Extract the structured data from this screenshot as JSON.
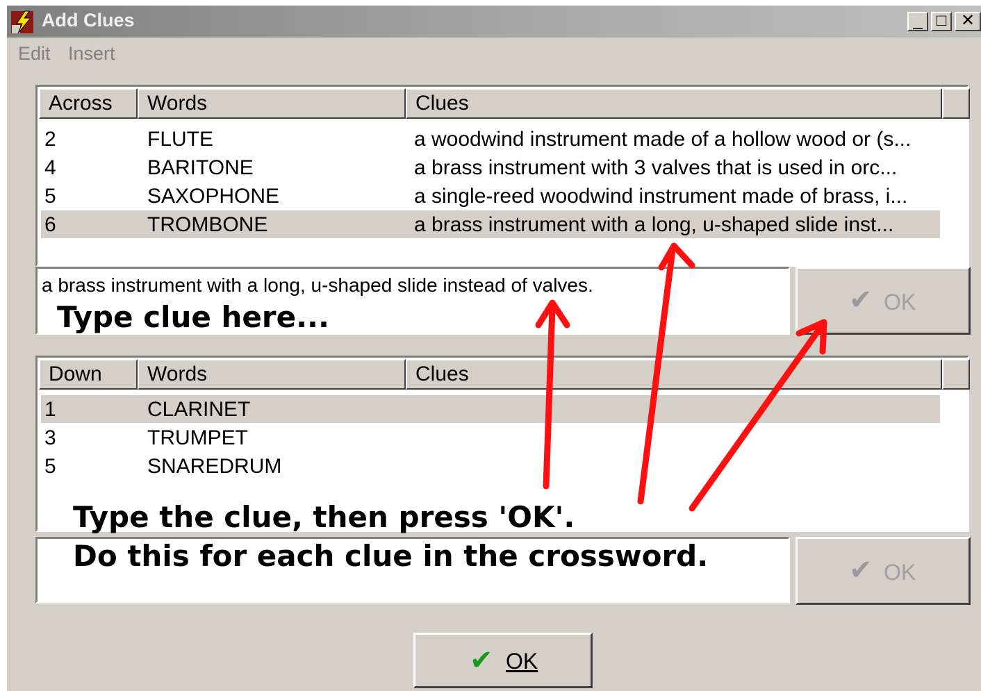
{
  "window": {
    "title": "Add Clues",
    "minimize": "_",
    "maximize": "□",
    "close": "✕"
  },
  "menu": {
    "edit": "Edit",
    "insert": "Insert"
  },
  "across": {
    "headers": [
      "Across",
      "Words",
      "Clues"
    ],
    "rows": [
      {
        "num": "2",
        "word": "FLUTE",
        "clue": "a woodwind instrument made of a hollow wood or (s..."
      },
      {
        "num": "4",
        "word": "BARITONE",
        "clue": "a brass instrument with 3 valves that is used in orc..."
      },
      {
        "num": "5",
        "word": "SAXOPHONE",
        "clue": "a single-reed woodwind instrument made of brass, i..."
      },
      {
        "num": "6",
        "word": "TROMBONE",
        "clue": "a brass instrument with a long, u-shaped slide inst...",
        "selected": true
      }
    ]
  },
  "across_clue_input": {
    "value": "a brass instrument with a long, u-shaped slide instead of valves.",
    "ok_label": "OK"
  },
  "down": {
    "headers": [
      "Down",
      "Words",
      "Clues"
    ],
    "rows": [
      {
        "num": "1",
        "word": "CLARINET",
        "clue": "",
        "selected": true
      },
      {
        "num": "3",
        "word": "TRUMPET",
        "clue": ""
      },
      {
        "num": "5",
        "word": "SNAREDRUM",
        "clue": ""
      }
    ]
  },
  "down_clue_input": {
    "value": "",
    "ok_label": "OK"
  },
  "main_ok_label": "OK",
  "annotations": {
    "type_clue_here": "Type clue here...",
    "instruction_line1": "Type the clue, then press 'OK'.",
    "instruction_line2": "Do this for each clue in the crossword.",
    "arrow_color": "#ff0000"
  },
  "colors": {
    "face": "#d4d0c8",
    "selected_row": "#d4d0c8",
    "check": "#1a9a1a"
  }
}
